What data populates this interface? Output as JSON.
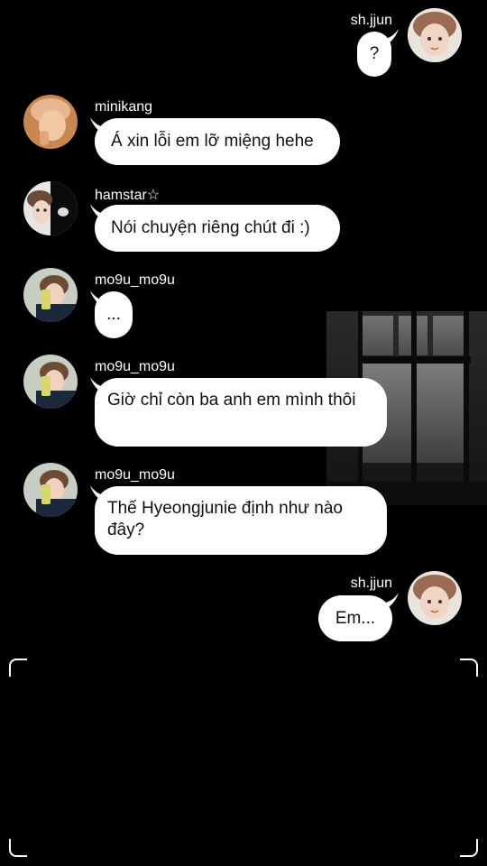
{
  "messages": [
    {
      "user": "sh.jjun",
      "text": "?",
      "side": "right"
    },
    {
      "user": "minikang",
      "text": "Á xin lỗi em lỡ miệng hehe",
      "side": "left"
    },
    {
      "user": "hamstar☆",
      "text": "Nói chuyện riêng chút đi :)",
      "side": "left"
    },
    {
      "user": "mo9u_mo9u",
      "text": "...",
      "side": "left"
    },
    {
      "user": "mo9u_mo9u",
      "text": "Giờ chỉ còn ba anh em mình thôi",
      "side": "left"
    },
    {
      "user": "mo9u_mo9u",
      "text": "Thế Hyeongjunie định như nào đây?",
      "side": "left"
    },
    {
      "user": "sh.jjun",
      "text": "Em...",
      "side": "right"
    }
  ],
  "avatars": {
    "shjjun": "portrait-avatar-light",
    "minikang": "portrait-avatar-warm",
    "hamstar": "split-portrait-avatar",
    "mo9u": "selfie-avatar-green"
  },
  "colors": {
    "bubble": "#ffffff",
    "background": "#000000",
    "text": "#111111"
  }
}
